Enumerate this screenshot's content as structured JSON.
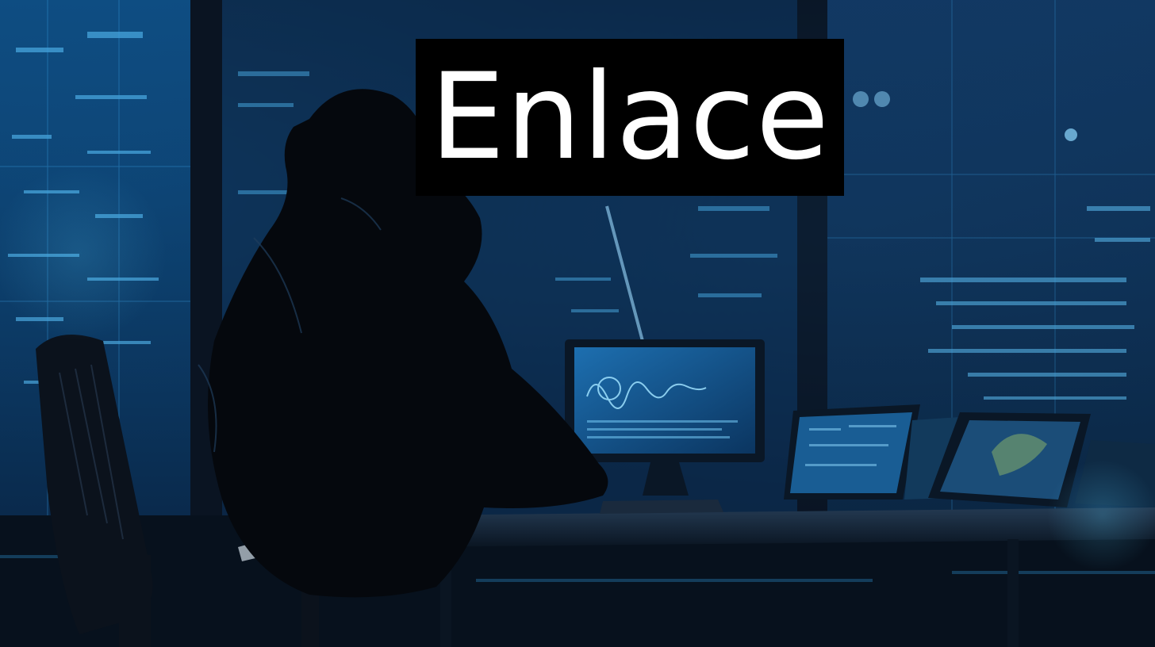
{
  "caption": {
    "title": "Enlace"
  },
  "scene": {
    "subject": "hooded-figure-at-computer",
    "palette": {
      "background": "#0a2a48",
      "glow": "#39b6ff",
      "silhouette": "#05080d",
      "title_box": "#000000",
      "title_text": "#ffffff"
    }
  }
}
